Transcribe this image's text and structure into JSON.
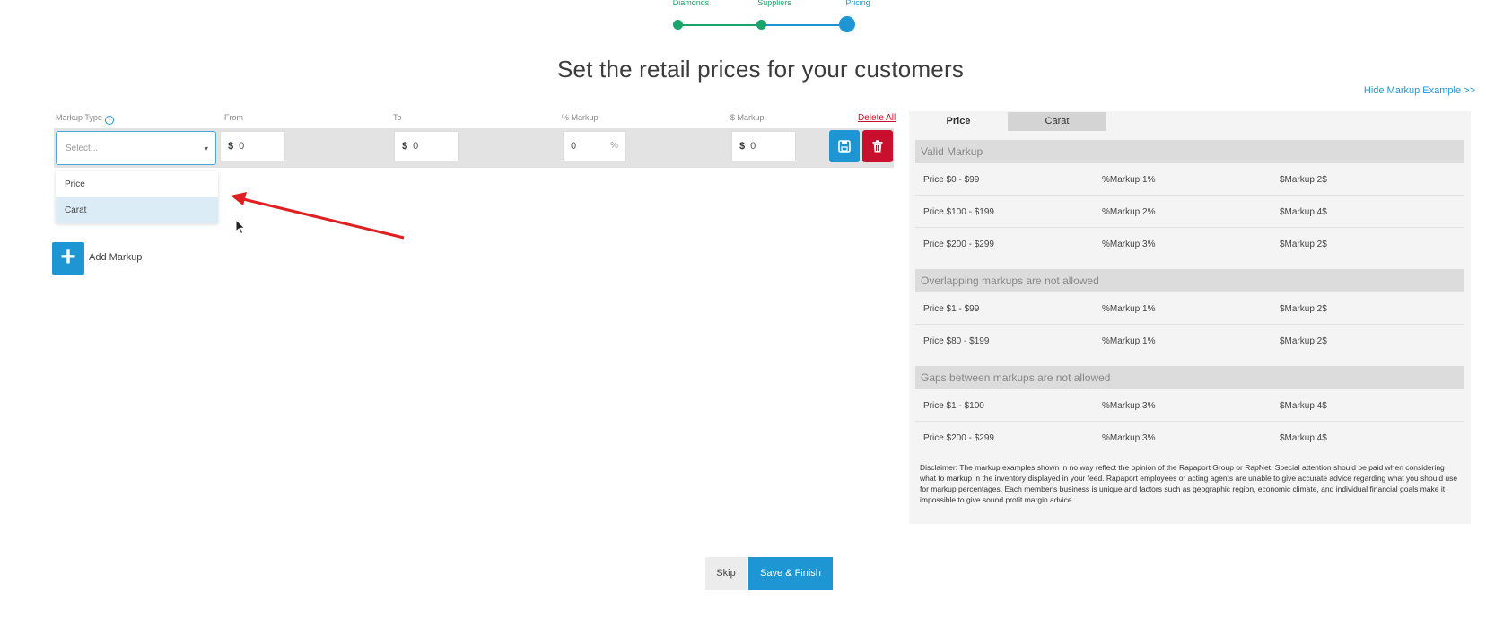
{
  "stepper": {
    "steps": [
      {
        "label": "Diamonds",
        "color": "#1aa36a"
      },
      {
        "label": "Suppliers",
        "color": "#1aa36a"
      },
      {
        "label": "Pricing",
        "color": "#1d96d3"
      }
    ]
  },
  "page_title": "Set the retail prices for your customers",
  "hide_link": "Hide Markup Example >>",
  "markup_form": {
    "col_markup_type": "Markup Type",
    "col_from": "From",
    "col_to": "To",
    "col_pct": "% Markup",
    "col_dollar": "$ Markup",
    "delete_all": "Delete All",
    "select_placeholder": "Select...",
    "from_prefix": "$",
    "from_value": "0",
    "to_prefix": "$",
    "to_value": "0",
    "pct_value": "0",
    "pct_suffix": "%",
    "dollar_prefix": "$",
    "dollar_value": "0",
    "dropdown_options": [
      "Price",
      "Carat"
    ],
    "add_label": "Add Markup"
  },
  "panel": {
    "tabs": [
      "Price",
      "Carat"
    ],
    "sections": [
      {
        "title": "Valid Markup",
        "rows": [
          [
            "Price $0 - $99",
            "%Markup 1%",
            "$Markup 2$"
          ],
          [
            "Price $100 - $199",
            "%Markup 2%",
            "$Markup 4$"
          ],
          [
            "Price $200 - $299",
            "%Markup 3%",
            "$Markup 2$"
          ]
        ]
      },
      {
        "title": "Overlapping markups are not allowed",
        "rows": [
          [
            "Price $1 - $99",
            "%Markup 1%",
            "$Markup 2$"
          ],
          [
            "Price $80 - $199",
            "%Markup 1%",
            "$Markup 2$"
          ]
        ]
      },
      {
        "title": "Gaps between markups are not allowed",
        "rows": [
          [
            "Price $1 - $100",
            "%Markup 3%",
            "$Markup 4$"
          ],
          [
            "Price $200 - $299",
            "%Markup 3%",
            "$Markup 4$"
          ]
        ]
      }
    ],
    "disclaimer": "Disclaimer: The markup examples shown in no way reflect the opinion of the Rapaport Group or RapNet. Special attention should be paid when considering what to markup in the inventory displayed in your feed. Rapaport employees or acting agents are unable to give accurate advice regarding what you should use for markup percentages. Each member's business is unique and factors such as geographic region, economic climate, and individual financial goals make it impossible to give sound profit margin advice."
  },
  "footer": {
    "skip": "Skip",
    "save_finish": "Save & Finish"
  },
  "colors": {
    "accent": "#1d96d3",
    "success": "#1aa36a",
    "danger": "#c8102e"
  }
}
